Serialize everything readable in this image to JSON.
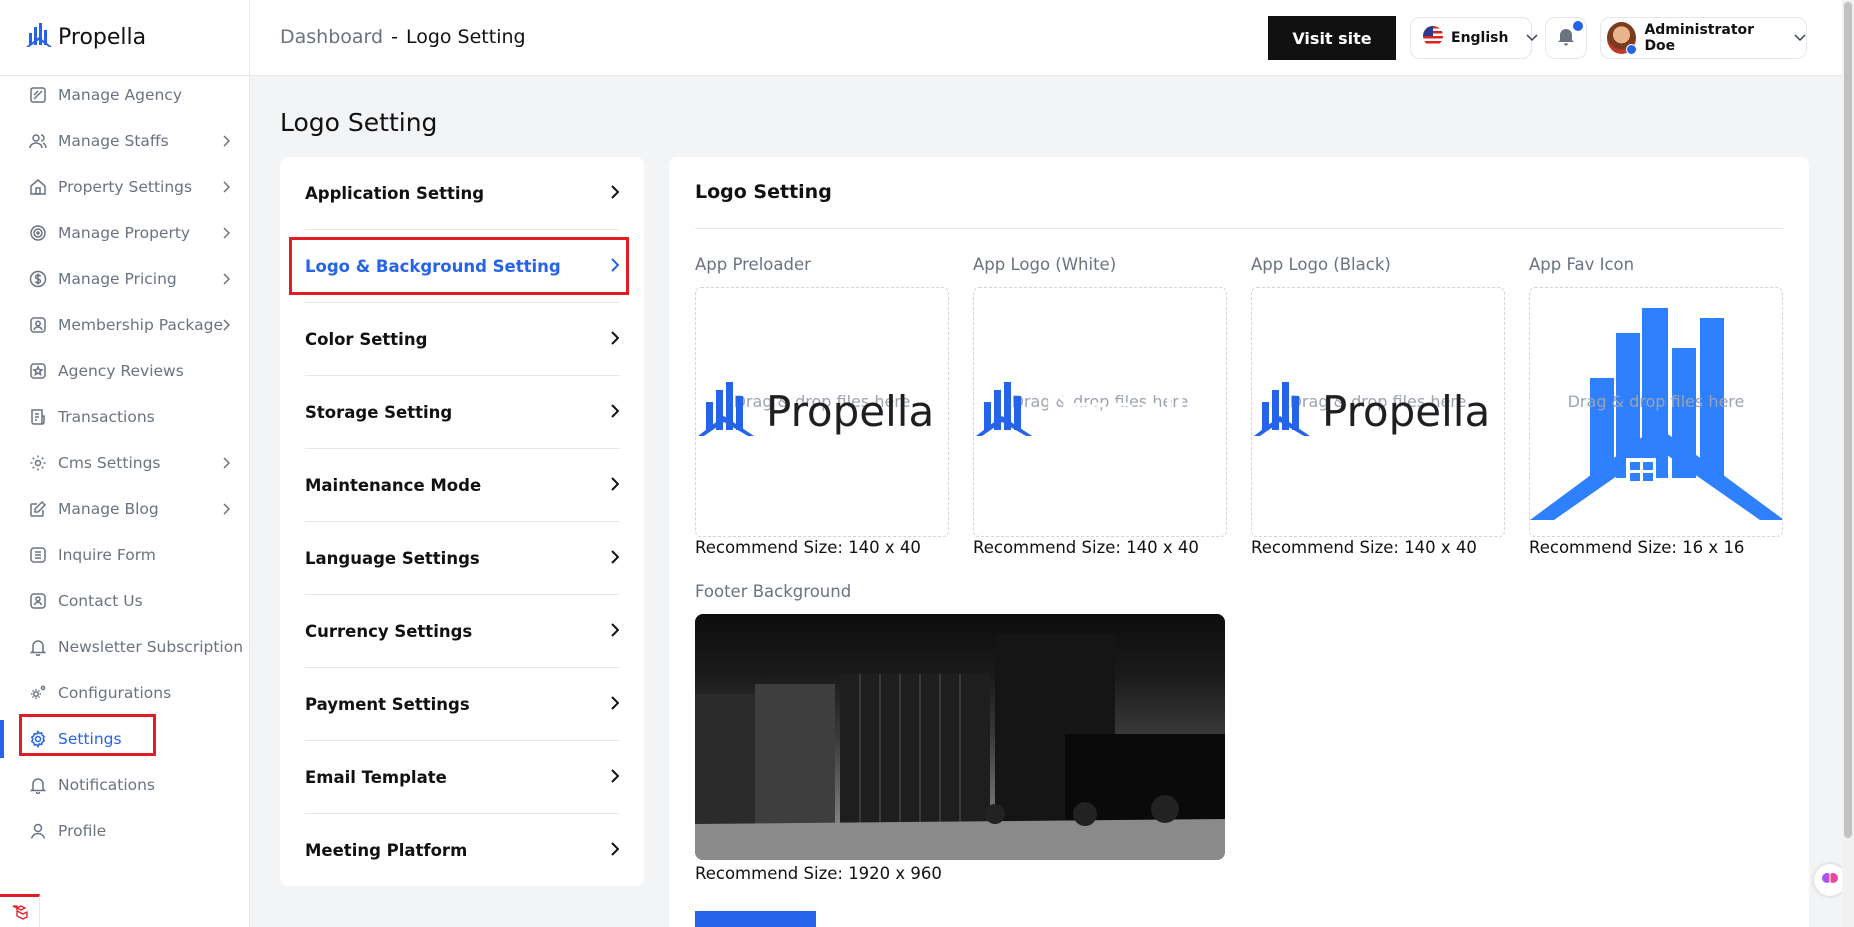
{
  "brand": {
    "name": "Propella",
    "accent": "#2563eb"
  },
  "sidebar": {
    "items": [
      {
        "label": "Manage Agency",
        "icon": "agency-icon",
        "chevron": false
      },
      {
        "label": "Manage Staffs",
        "icon": "users-icon",
        "chevron": true
      },
      {
        "label": "Property Settings",
        "icon": "home-icon",
        "chevron": true
      },
      {
        "label": "Manage Property",
        "icon": "target-icon",
        "chevron": true
      },
      {
        "label": "Manage Pricing",
        "icon": "dollar-icon",
        "chevron": true
      },
      {
        "label": "Membership Package",
        "icon": "id-card-icon",
        "chevron": true
      },
      {
        "label": "Agency Reviews",
        "icon": "star-icon",
        "chevron": false
      },
      {
        "label": "Transactions",
        "icon": "receipt-icon",
        "chevron": false
      },
      {
        "label": "Cms Settings",
        "icon": "gear-icon",
        "chevron": true
      },
      {
        "label": "Manage Blog",
        "icon": "edit-icon",
        "chevron": true
      },
      {
        "label": "Inquire Form",
        "icon": "list-icon",
        "chevron": false
      },
      {
        "label": "Contact Us",
        "icon": "contact-icon",
        "chevron": false
      },
      {
        "label": "Newsletter Subscription",
        "icon": "bell-icon",
        "chevron": false
      },
      {
        "label": "Configurations",
        "icon": "cogs-icon",
        "chevron": false
      },
      {
        "label": "Settings",
        "icon": "gear-icon",
        "chevron": false,
        "active": true
      },
      {
        "label": "Notifications",
        "icon": "bell-icon",
        "chevron": false
      },
      {
        "label": "Profile",
        "icon": "user-icon",
        "chevron": false
      }
    ]
  },
  "header": {
    "breadcrumb_root": "Dashboard",
    "breadcrumb_sep": "-",
    "breadcrumb_current": "Logo Setting",
    "visit_site": "Visit site",
    "language": "English",
    "user_name": "Administrator Doe"
  },
  "page": {
    "title": "Logo Setting"
  },
  "settings_menu": [
    {
      "label": "Application Setting"
    },
    {
      "label": "Logo & Background Setting",
      "active": true
    },
    {
      "label": "Color Setting"
    },
    {
      "label": "Storage Setting"
    },
    {
      "label": "Maintenance Mode"
    },
    {
      "label": "Language Settings"
    },
    {
      "label": "Currency Settings"
    },
    {
      "label": "Payment Settings"
    },
    {
      "label": "Email Template"
    },
    {
      "label": "Meeting Platform"
    }
  ],
  "logo_panel": {
    "title": "Logo Setting",
    "uploads": [
      {
        "label": "App Preloader",
        "drop_text": "Drag & drop files here",
        "recommend": "Recommend Size: 140 x 40",
        "preview": "full-logo-dark"
      },
      {
        "label": "App Logo (White)",
        "drop_text": "Drag & drop files here",
        "recommend": "Recommend Size: 140 x 40",
        "preview": "full-logo-white"
      },
      {
        "label": "App Logo (Black)",
        "drop_text": "Drag & drop files here",
        "recommend": "Recommend Size: 140 x 40",
        "preview": "full-logo-dark"
      },
      {
        "label": "App Fav Icon",
        "drop_text": "Drag & drop files here",
        "recommend": "Recommend Size: 16 x 16",
        "preview": "mark-only"
      }
    ],
    "footer": {
      "label": "Footer Background",
      "recommend": "Recommend Size: 1920 x 960"
    }
  }
}
